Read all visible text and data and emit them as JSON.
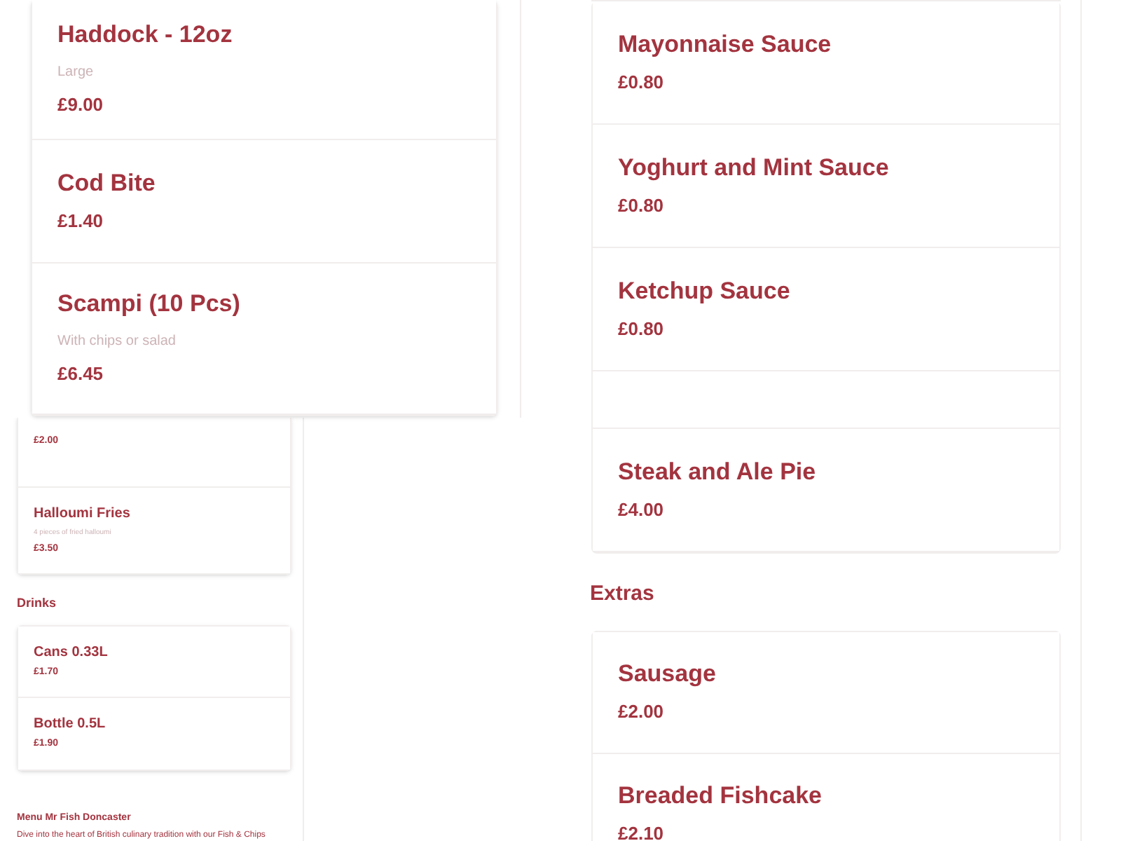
{
  "overlay_items": [
    {
      "name": "Haddock - 12oz",
      "description": "Large",
      "price": "£9.00"
    },
    {
      "name": "Cod Bite",
      "price": "£1.40"
    },
    {
      "name": "Scampi (10 Pcs)",
      "description": "With chips or salad",
      "price": "£6.45"
    }
  ],
  "left_sections": [
    {
      "items": [
        {
          "price": "£2.00"
        },
        {
          "name": "Halloumi Fries",
          "description": "4 pieces of fried halloumi",
          "price": "£3.50"
        }
      ]
    },
    {
      "title": "Drinks",
      "items": [
        {
          "name": "Cans 0.33L",
          "price": "£1.70"
        },
        {
          "name": "Bottle 0.5L",
          "price": "£1.90"
        }
      ]
    }
  ],
  "footer": {
    "title": "Menu Mr Fish Doncaster",
    "text": "Dive into the heart of British culinary tradition with our Fish & Chips"
  },
  "right_sections": [
    {
      "items": [
        {
          "kind": "item",
          "name": "Mayonnaise Sauce",
          "price": "£0.80"
        },
        {
          "kind": "item",
          "name": "Yoghurt and Mint Sauce",
          "price": "£0.80"
        },
        {
          "kind": "item",
          "name": "Ketchup Sauce",
          "price": "£0.80"
        },
        {
          "kind": "covered"
        },
        {
          "kind": "item",
          "name": "Steak and Ale Pie",
          "price": "£4.00"
        }
      ]
    },
    {
      "title": "Extras",
      "items": [
        {
          "name": "Sausage",
          "price": "£2.00"
        },
        {
          "name": "Breaded Fishcake",
          "price": "£2.10"
        }
      ]
    }
  ]
}
